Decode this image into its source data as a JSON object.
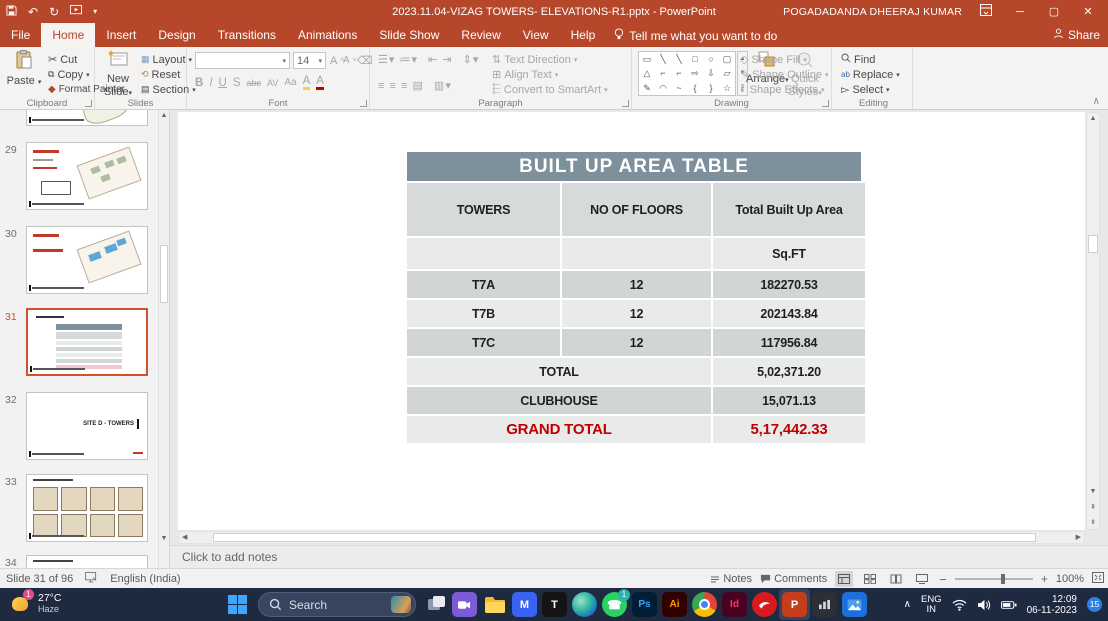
{
  "colors": {
    "titlebar": "#b7472a",
    "accent_red": "#c00000",
    "table_header_bg": "#7d909b",
    "row_dark": "#d2d5d6",
    "row_light": "#e9ebeb",
    "taskbar_bg": "#1e2a40",
    "selection": "#d0512e"
  },
  "titlebar": {
    "title": "2023.11.04-VIZAG TOWERS- ELEVATIONS-R1.pptx  -  PowerPoint",
    "user": "POGADADANDA DHEERAJ KUMAR",
    "minimize": "─",
    "restore": "▢",
    "close": "✕"
  },
  "qat": {
    "undo": "↶",
    "redo": "↻",
    "present": "▶",
    "more": "▾"
  },
  "tabs": {
    "file": "File",
    "home": "Home",
    "insert": "Insert",
    "design": "Design",
    "transitions": "Transitions",
    "animations": "Animations",
    "slideshow": "Slide Show",
    "review": "Review",
    "view": "View",
    "help": "Help",
    "tellme": "Tell me what you want to do",
    "share": "Share"
  },
  "ribbon": {
    "clipboard": {
      "label": "Clipboard",
      "paste": "Paste",
      "cut": "Cut",
      "copy": "Copy",
      "format_painter": "Format Painter"
    },
    "slides": {
      "label": "Slides",
      "new1": "New",
      "new2": "Slide",
      "layout": "Layout",
      "reset": "Reset",
      "section": "Section"
    },
    "font": {
      "label": "Font",
      "size": "14",
      "b": "B",
      "i": "I",
      "u": "U",
      "s": "S",
      "abc": "abc",
      "av": "AV",
      "aa": "Aa",
      "hl": "A",
      "color": "A",
      "grow": "A",
      "shrink": "A"
    },
    "paragraph": {
      "label": "Paragraph",
      "text_direction": "Text Direction",
      "align_text": "Align Text",
      "convert": "Convert to SmartArt"
    },
    "drawing": {
      "label": "Drawing",
      "arrange": "Arrange",
      "quick1": "Quick",
      "quick2": "Styles",
      "shape_fill": "Shape Fill",
      "shape_outline": "Shape Outline",
      "shape_effects": "Shape Effects",
      "shapes": [
        "▭",
        "╲",
        "╲",
        "□",
        "○",
        "▢",
        "△",
        "⌐",
        "⌐",
        "⇨",
        "⇩",
        "▱",
        "✎",
        "◠",
        "~",
        "{",
        "}",
        "☆"
      ]
    },
    "editing": {
      "label": "Editing",
      "find": "Find",
      "replace": "Replace",
      "select": "Select"
    }
  },
  "thumbnails": {
    "items": [
      {
        "number": "29"
      },
      {
        "number": "30"
      },
      {
        "number": "31"
      },
      {
        "number": "32",
        "caption": "SITE D - TOWERS"
      },
      {
        "number": "33"
      },
      {
        "number": "34"
      }
    ]
  },
  "slide_table": {
    "title": "BUILT UP AREA TABLE",
    "headers": [
      "TOWERS",
      "NO OF FLOORS",
      "Total Built Up Area"
    ],
    "unit": "Sq.FT",
    "rows": [
      [
        "T7A",
        "12",
        "182270.53"
      ],
      [
        "T7B",
        "12",
        "202143.84"
      ],
      [
        "T7C",
        "12",
        "117956.84"
      ]
    ],
    "total": {
      "label": "TOTAL",
      "value": "5,02,371.20"
    },
    "clubhouse": {
      "label": "CLUBHOUSE",
      "value": "15,071.13"
    },
    "grand": {
      "label": "GRAND TOTAL",
      "value": "5,17,442.33"
    }
  },
  "notes": {
    "placeholder": "Click to add notes"
  },
  "statusbar": {
    "slide_counter": "Slide 31 of 96",
    "language": "English (India)",
    "notes": "Notes",
    "comments": "Comments",
    "zoom": "100%"
  },
  "taskbar": {
    "weather": {
      "temp": "27°C",
      "condition": "Haze",
      "badge": "1"
    },
    "search": "Search",
    "whatsapp_badge": "1",
    "apps": {
      "m": "M",
      "t": "T",
      "ps": "Ps",
      "ai": "Ai",
      "id": "Id",
      "ppt": "P",
      "phone": "☎"
    },
    "tray": {
      "lang1": "ENG",
      "lang2": "IN",
      "time": "12:09",
      "date": "06-11-2023",
      "badge": "15"
    }
  }
}
